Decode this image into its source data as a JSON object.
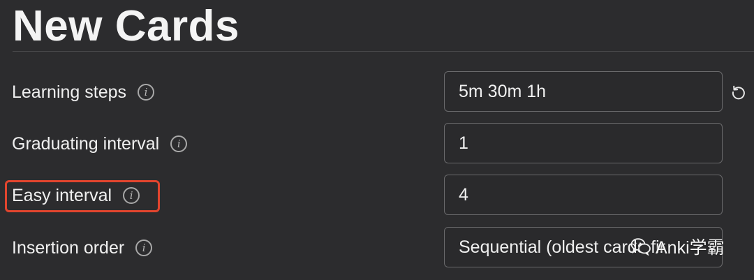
{
  "section": {
    "title": "New Cards"
  },
  "rows": [
    {
      "label": "Learning steps",
      "value": "5m 30m 1h"
    },
    {
      "label": "Graduating interval",
      "value": "1"
    },
    {
      "label": "Easy interval",
      "value": "4"
    },
    {
      "label": "Insertion order",
      "value": "Sequential (oldest cards fir"
    }
  ],
  "icons": {
    "info": "info-icon",
    "reset": "reset-icon",
    "watermark": "wechat-icon"
  },
  "info_glyph": "i",
  "watermark": {
    "text": "Anki学霸"
  },
  "colors": {
    "background": "#2c2c2e",
    "field_border": "#6a6a6c",
    "highlight": "#e2452e"
  }
}
